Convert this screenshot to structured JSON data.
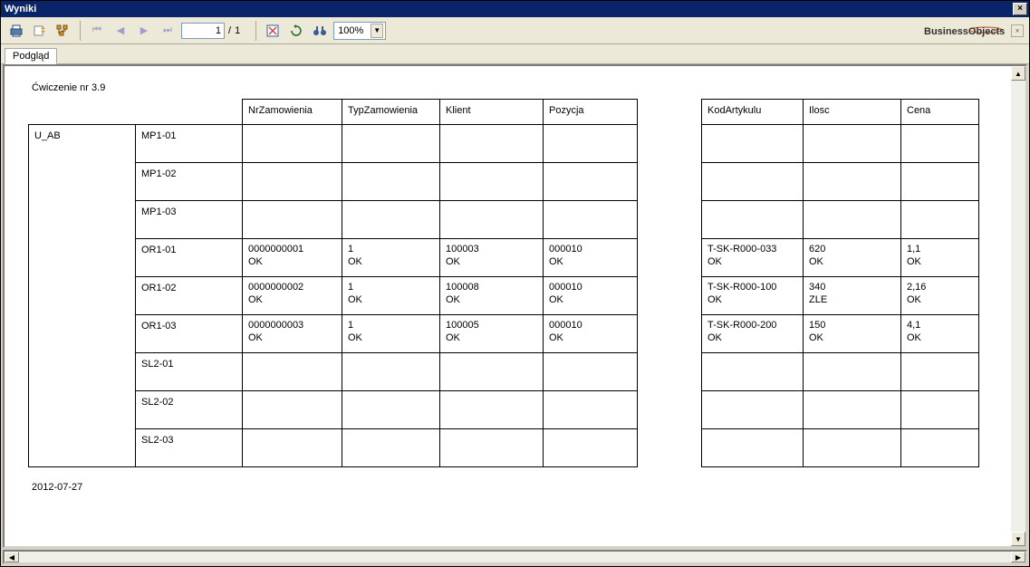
{
  "window": {
    "title": "Wyniki",
    "close_glyph": "×"
  },
  "toolbar": {
    "page_value": "1",
    "page_sep": "/",
    "page_total": "1",
    "zoom": "100%"
  },
  "brand": {
    "text": "BusinessObjects"
  },
  "tabs": {
    "preview": "Podgląd"
  },
  "report": {
    "title": "Ćwiczenie nr 3.9",
    "date": "2012-07-27",
    "group_label": "U_AB",
    "left_headers": [
      "NrZamowienia",
      "TypZamowienia",
      "Klient",
      "Pozycja"
    ],
    "right_headers": [
      "KodArtykulu",
      "Ilosc",
      "Cena"
    ],
    "rows": [
      {
        "item": "MP1-01",
        "left": [
          "",
          "",
          "",
          ""
        ],
        "right": [
          "",
          "",
          ""
        ]
      },
      {
        "item": "MP1-02",
        "left": [
          "",
          "",
          "",
          ""
        ],
        "right": [
          "",
          "",
          ""
        ]
      },
      {
        "item": "MP1-03",
        "left": [
          "",
          "",
          "",
          ""
        ],
        "right": [
          "",
          "",
          ""
        ]
      },
      {
        "item": "OR1-01",
        "left": [
          "0000000001\nOK",
          "1\nOK",
          "100003\nOK",
          "000010\nOK"
        ],
        "right": [
          "T-SK-R000-033\nOK",
          "620\nOK",
          "1,1\nOK"
        ]
      },
      {
        "item": "OR1-02",
        "left": [
          "0000000002\nOK",
          "1\nOK",
          "100008\nOK",
          "000010\nOK"
        ],
        "right": [
          "T-SK-R000-100\nOK",
          "340\nZLE",
          "2,16\nOK"
        ]
      },
      {
        "item": "OR1-03",
        "left": [
          "0000000003\nOK",
          "1\nOK",
          "100005\nOK",
          "000010\nOK"
        ],
        "right": [
          "T-SK-R000-200\nOK",
          "150\nOK",
          "4,1\nOK"
        ]
      },
      {
        "item": "SL2-01",
        "left": [
          "",
          "",
          "",
          ""
        ],
        "right": [
          "",
          "",
          ""
        ]
      },
      {
        "item": "SL2-02",
        "left": [
          "",
          "",
          "",
          ""
        ],
        "right": [
          "",
          "",
          ""
        ]
      },
      {
        "item": "SL2-03",
        "left": [
          "",
          "",
          "",
          ""
        ],
        "right": [
          "",
          "",
          ""
        ]
      }
    ]
  }
}
